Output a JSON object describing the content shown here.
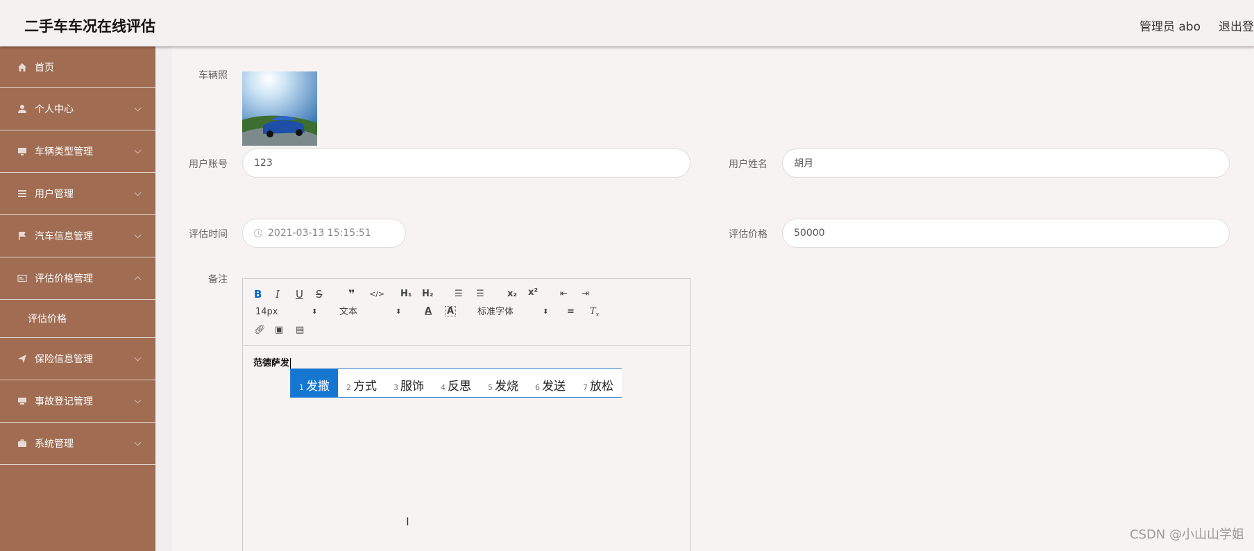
{
  "header": {
    "title": "二手车车况在线评估",
    "user_label": "管理员 abo",
    "logout_label": "退出登"
  },
  "sidebar": {
    "items": [
      {
        "label": "首页"
      },
      {
        "label": "个人中心"
      },
      {
        "label": "车辆类型管理"
      },
      {
        "label": "用户管理"
      },
      {
        "label": "汽车信息管理"
      },
      {
        "label": "评估价格管理"
      },
      {
        "label": "保险信息管理"
      },
      {
        "label": "事故登记管理"
      },
      {
        "label": "系统管理"
      }
    ],
    "submenu": {
      "label": "评估价格"
    }
  },
  "form": {
    "photo_label": "车辆照",
    "account_label": "用户账号",
    "account_value": "123",
    "name_label": "用户姓名",
    "name_value": "胡月",
    "time_label": "评估时间",
    "time_value": "2021-03-13 15:15:51",
    "price_label": "评估价格",
    "price_value": "50000",
    "note_label": "备注"
  },
  "editor": {
    "font_size": "14px",
    "text_style": "文本",
    "font_family": "标准字体",
    "content": "范德萨发"
  },
  "ime": {
    "candidates": [
      {
        "n": "1",
        "text": "发撒"
      },
      {
        "n": "2",
        "text": "方式"
      },
      {
        "n": "3",
        "text": "服饰"
      },
      {
        "n": "4",
        "text": "反思"
      },
      {
        "n": "5",
        "text": "发烧"
      },
      {
        "n": "6",
        "text": "发送"
      },
      {
        "n": "7",
        "text": "放松"
      }
    ]
  },
  "watermark": "CSDN @小山山学姐"
}
